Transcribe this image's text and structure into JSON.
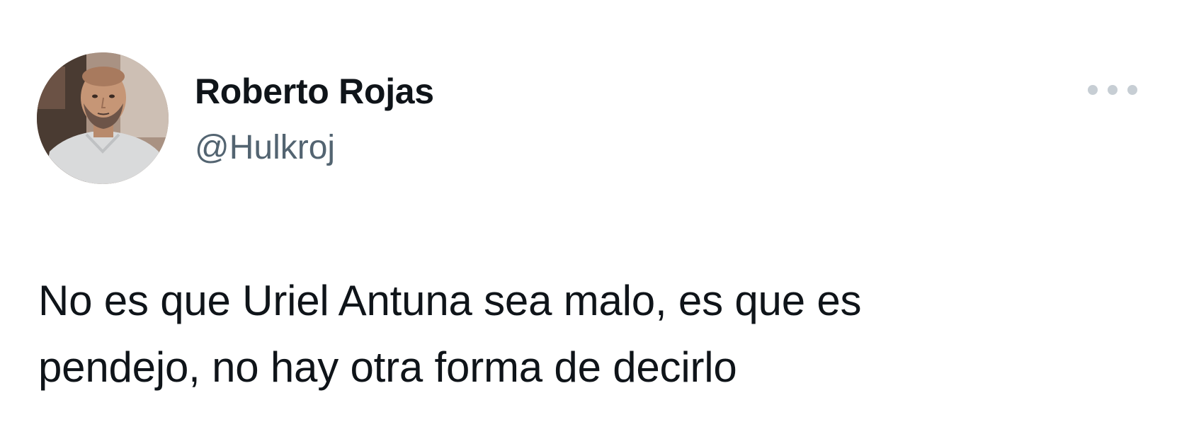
{
  "author": {
    "display_name": "Roberto Rojas",
    "handle": "@Hulkroj",
    "avatar_icon": "profile-photo"
  },
  "tweet": {
    "text_lines": [
      "No es que Uriel Antuna sea malo, es que es",
      "pendejo, no hay otra forma de decirlo"
    ]
  },
  "more_menu": {
    "icon": "more-horizontal-icon"
  },
  "colors": {
    "text": "#0f1419",
    "secondary_text": "#536471",
    "icon_muted": "#c7ced4",
    "background": "#ffffff"
  }
}
